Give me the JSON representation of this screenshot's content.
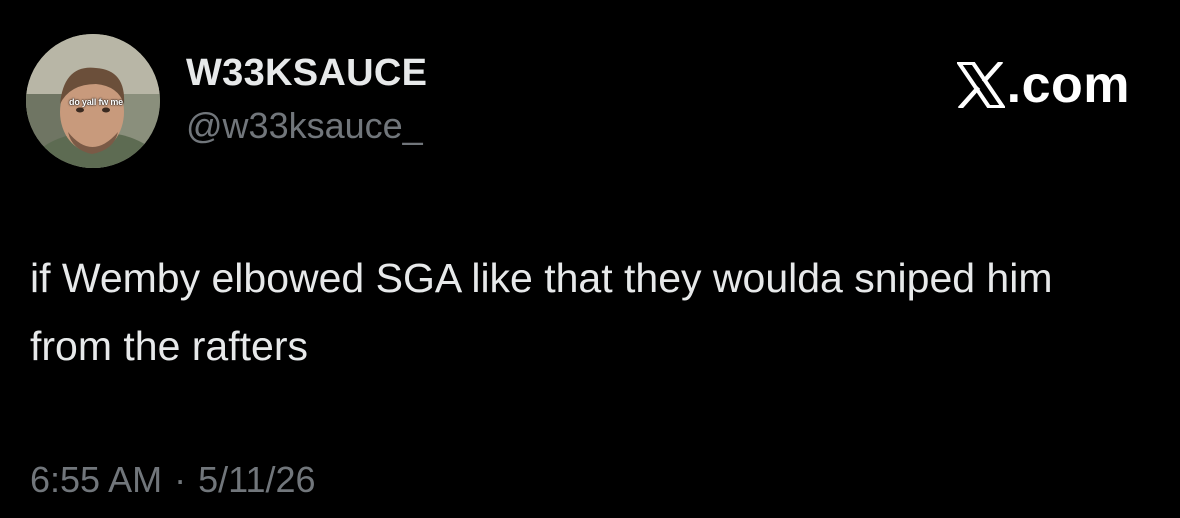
{
  "author": {
    "display_name": "W33KSAUCE",
    "handle": "@w33ksauce_",
    "avatar_caption": "do yall fw me",
    "avatar_icon": "user-avatar-photo"
  },
  "brand": {
    "label": ".com",
    "icon": "x-logo-icon"
  },
  "tweet": {
    "text": "if Wemby elbowed SGA like that they woulda sniped him from the rafters",
    "time": "6:55 AM",
    "separator": "·",
    "date": "5/11/26"
  },
  "colors": {
    "background": "#000000",
    "primary_text": "#e7e9ea",
    "secondary_text": "#71767b"
  }
}
